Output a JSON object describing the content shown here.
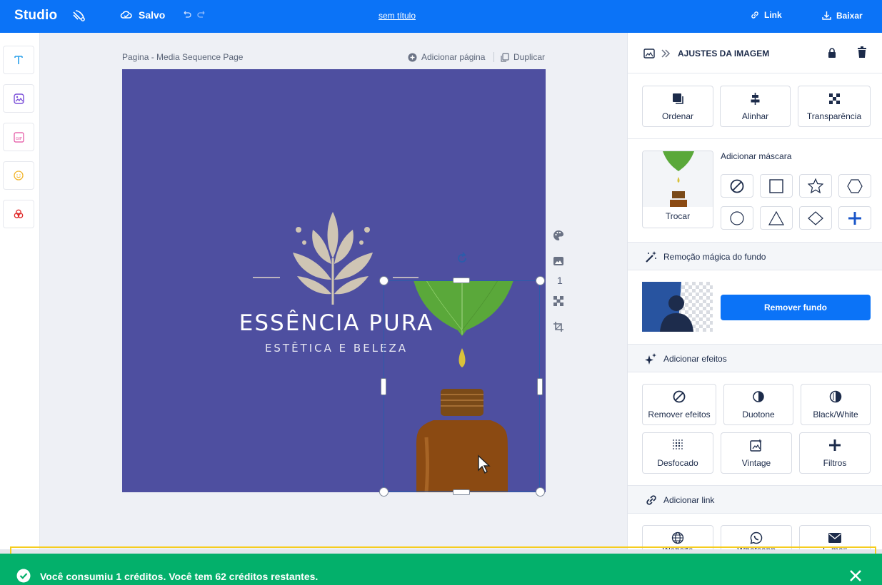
{
  "topbar": {
    "brand": "Studio",
    "saved_label": "Salvo",
    "doc_title": "sem título",
    "link_label": "Link",
    "download_label": "Baixar",
    "accent": "#0b73f7"
  },
  "tools": [
    "text-tool",
    "image-tool",
    "gif-tool",
    "emoji-tool",
    "effects-tool"
  ],
  "canvas": {
    "page_label": "Pagina - Media Sequence Page",
    "add_page": "Adicionar página",
    "duplicate": "Duplicar",
    "design_bg": "#4e4fa0",
    "brand_title": "ESSÊNCIA PURA",
    "brand_subtitle": "ESTÊTICA E BELEZA",
    "page_number": "1"
  },
  "panel": {
    "breadcrumb": "AJUSTES DA IMAGEM",
    "order": "Ordenar",
    "align": "Alinhar",
    "transparency": "Transparência",
    "add_mask": "Adicionar máscara",
    "swap": "Trocar",
    "bg_removal_header": "Remoção mágica do fundo",
    "remove_bg": "Remover fundo",
    "effects_header": "Adicionar efeitos",
    "effects": {
      "remove": "Remover efeitos",
      "duotone": "Duotone",
      "bw": "Black/White",
      "blur": "Desfocado",
      "vintage": "Vintage",
      "filters": "Filtros"
    },
    "link_header": "Adicionar link",
    "links": {
      "website": "Website",
      "whatsapp": "Whatsapp",
      "email": "E-mail"
    }
  },
  "toast": {
    "message": "Você consumiu 1 créditos. Você tem 62 créditos restantes.",
    "color": "#03b06b"
  }
}
